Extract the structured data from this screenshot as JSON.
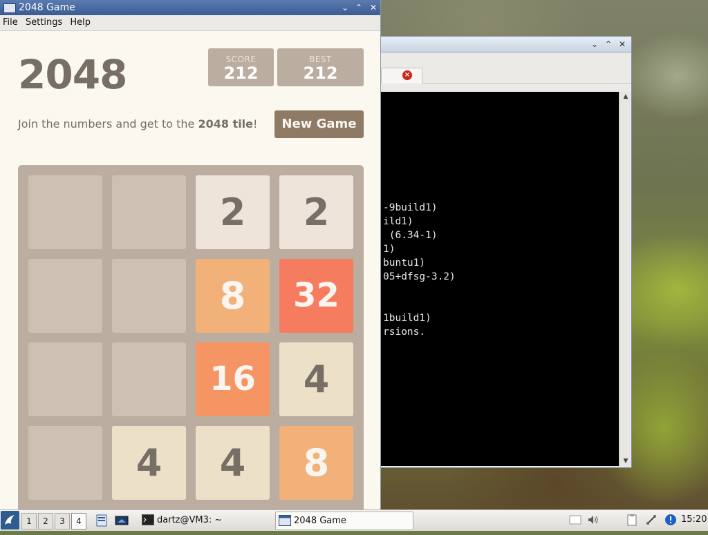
{
  "game_window": {
    "title": "2048 Game",
    "menu": [
      "File",
      "Settings",
      "Help"
    ],
    "heading": "2048",
    "score_label": "SCORE",
    "score_value": "212",
    "best_label": "BEST",
    "best_value": "212",
    "intro_prefix": "Join the numbers and get to the ",
    "intro_bold": "2048 tile",
    "intro_suffix": "!",
    "new_game_label": "New Game",
    "board": [
      [
        "",
        "",
        "2",
        "2"
      ],
      [
        "",
        "",
        "8",
        "32"
      ],
      [
        "",
        "",
        "16",
        "4"
      ],
      [
        "",
        "4",
        "4",
        "8"
      ]
    ]
  },
  "terminal_window": {
    "lines": [
      {
        "row": 0,
        "text": "-9build1)"
      },
      {
        "row": 1,
        "text": "ild1)"
      },
      {
        "row": 2,
        "text": " (6.34-1)"
      },
      {
        "row": 3,
        "text": "1)"
      },
      {
        "row": 4,
        "text": "buntu1)"
      },
      {
        "row": 5,
        "text": "05+dfsg-3.2)"
      },
      {
        "row": 8,
        "text": "1build1)"
      },
      {
        "row": 9,
        "text": "rsions."
      }
    ]
  },
  "taskbar": {
    "workspaces": [
      "1",
      "2",
      "3",
      "4"
    ],
    "active_workspace": "4",
    "tasks": [
      {
        "label": "dartz@VM3: ~",
        "icon": "terminal-icon"
      },
      {
        "label": "2048 Game",
        "icon": "window-icon"
      }
    ],
    "clock": "15:20"
  },
  "tile_colors": {
    "empty": "#cdc1b4",
    "2": "#eee4da",
    "4": "#ede0c8",
    "8": "#f2b179",
    "16": "#f59563",
    "32": "#f67c5f"
  }
}
